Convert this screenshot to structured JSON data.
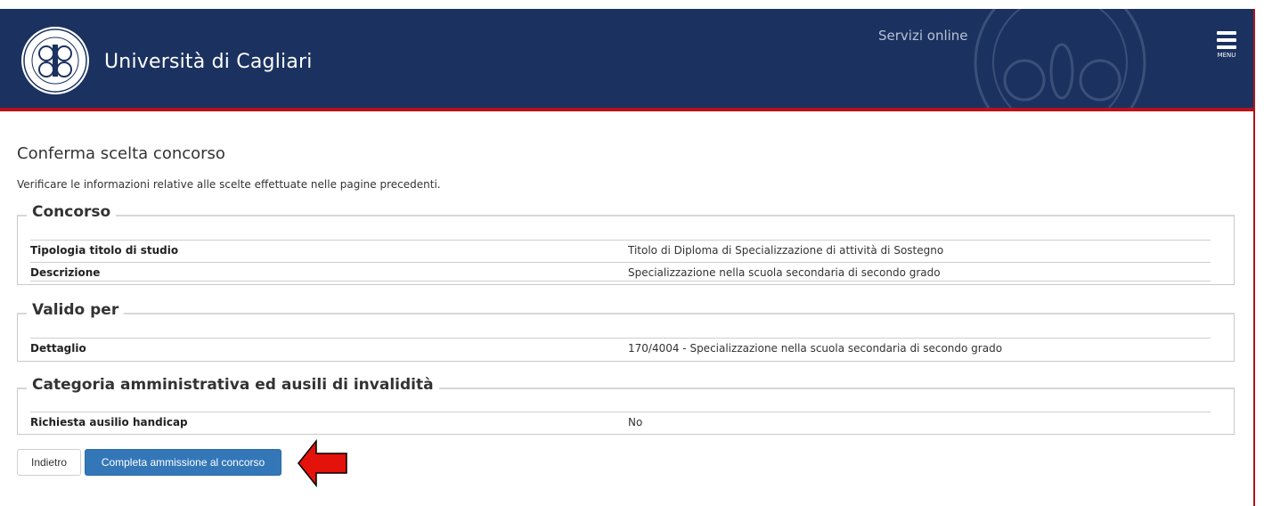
{
  "header": {
    "university_name": "Università di Cagliari",
    "services_label": "Servizi online",
    "menu_label": "MENU",
    "brand_color": "#1b3260",
    "accent_color": "#b5121b"
  },
  "page": {
    "title": "Conferma scelta concorso",
    "intro": "Verificare le informazioni relative alle scelte effettuate nelle pagine precedenti."
  },
  "sections": [
    {
      "legend": "Concorso",
      "rows": [
        {
          "label": "Tipologia titolo di studio",
          "value": "Titolo di Diploma di Specializzazione di attività di Sostegno"
        },
        {
          "label": "Descrizione",
          "value": "Specializzazione nella scuola secondaria di secondo grado"
        }
      ]
    },
    {
      "legend": "Valido per",
      "rows": [
        {
          "label": "Dettaglio",
          "value": "170/4004 - Specializzazione nella scuola secondaria di secondo grado"
        }
      ]
    },
    {
      "legend": "Categoria amministrativa ed ausili di invalidità",
      "rows": [
        {
          "label": "Richiesta ausilio handicap",
          "value": "No"
        }
      ]
    }
  ],
  "actions": {
    "back_label": "Indietro",
    "submit_label": "Completa ammissione al concorso"
  },
  "icons": {
    "logo": "university-seal-icon",
    "menu": "hamburger-menu-icon",
    "annotation": "red-left-arrow-icon"
  }
}
